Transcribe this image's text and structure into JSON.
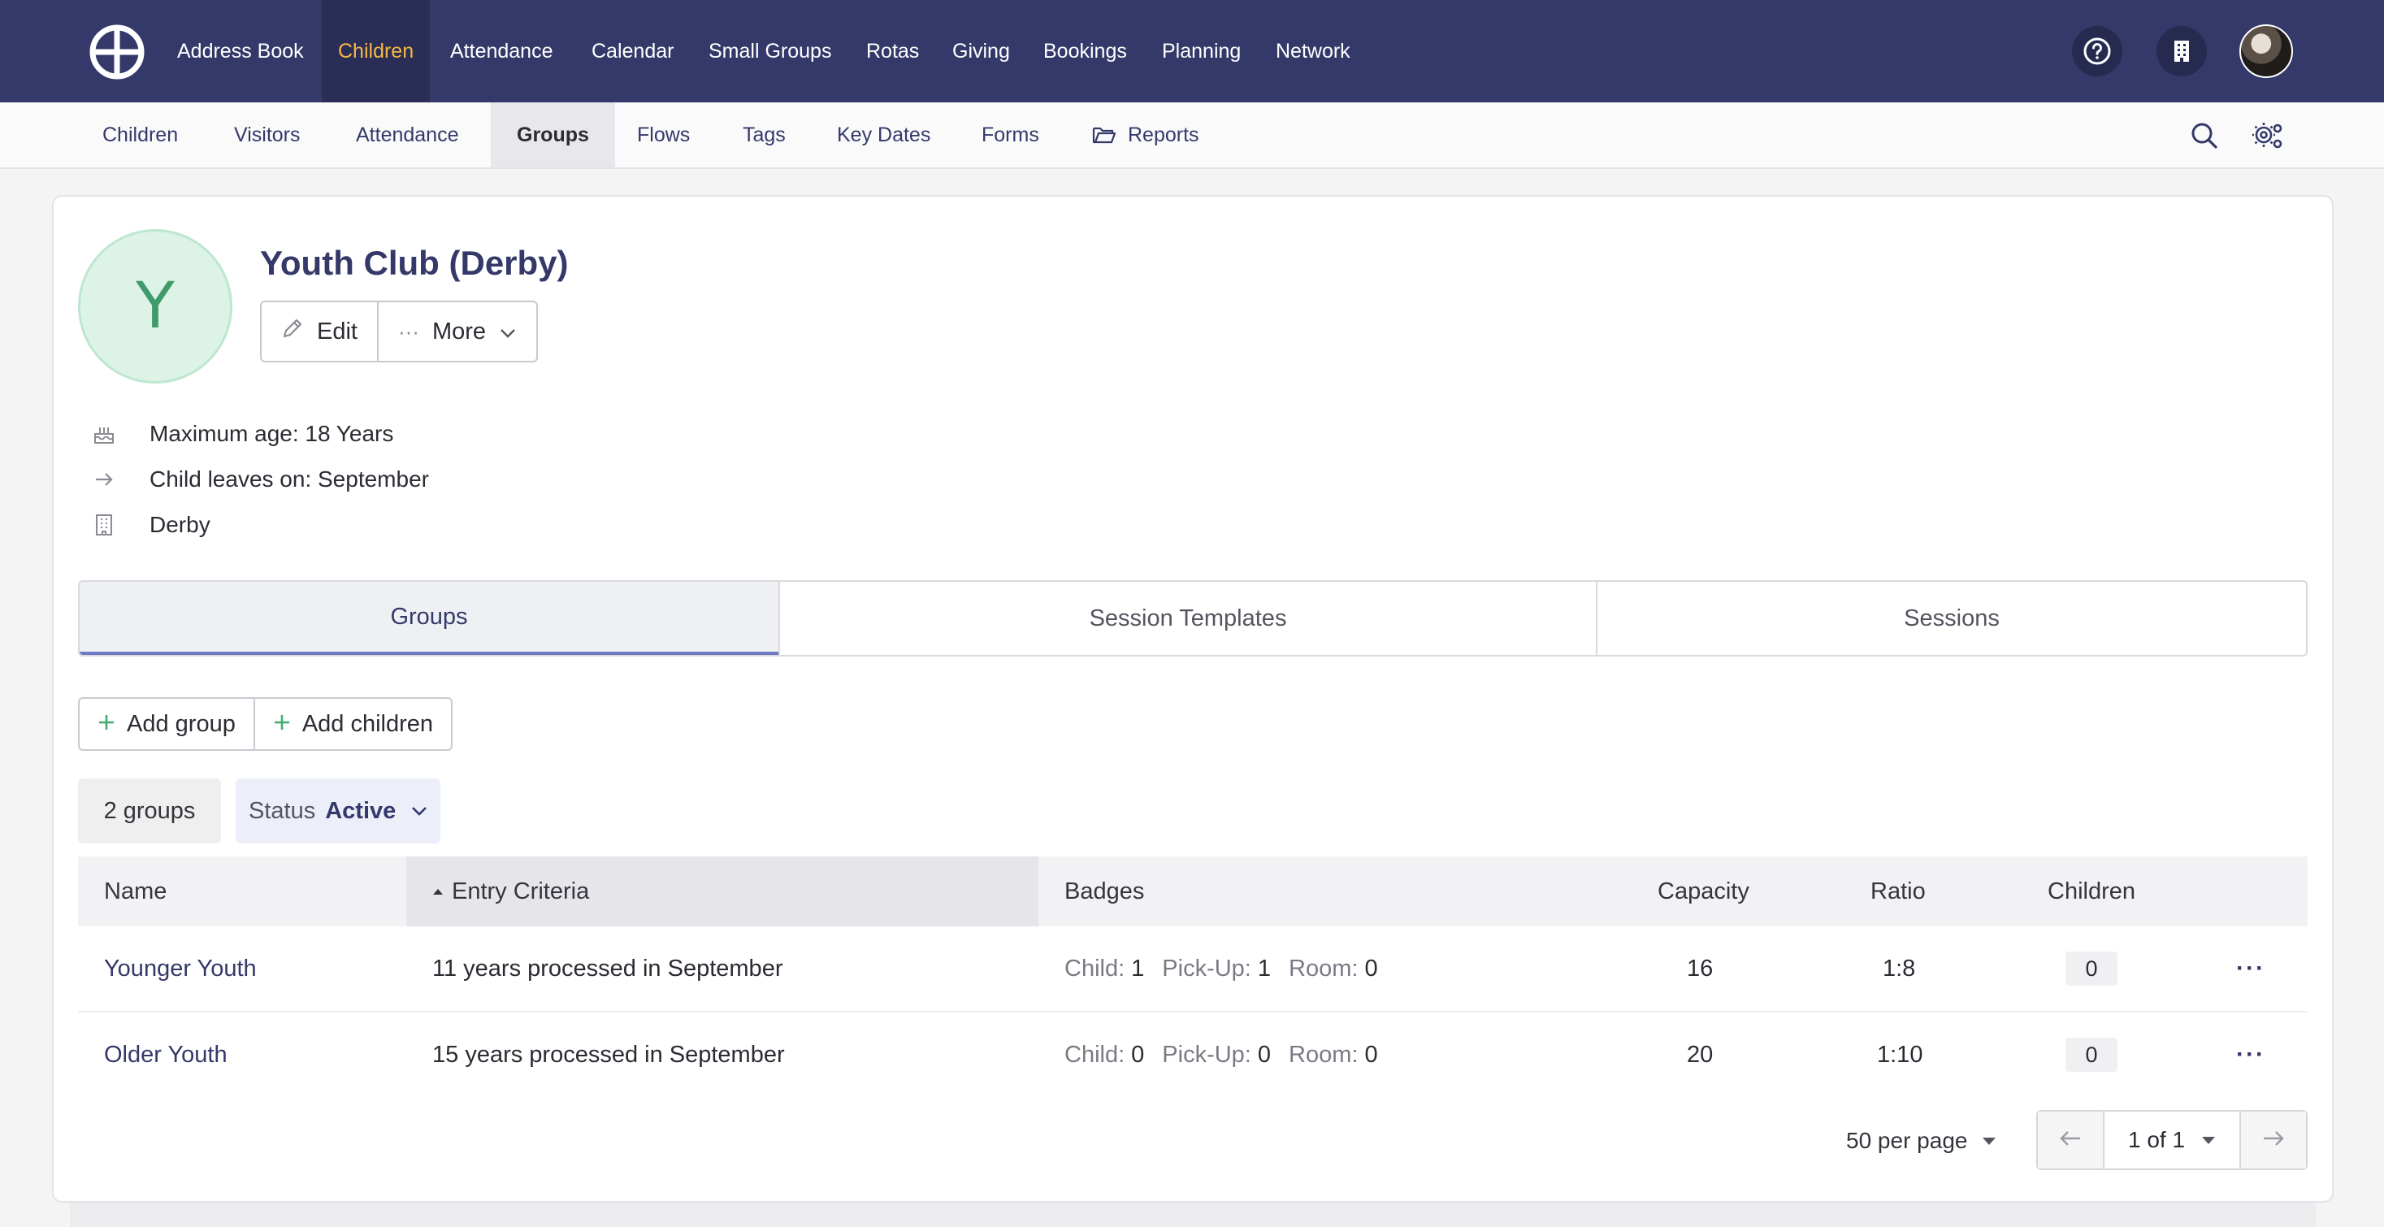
{
  "topnav": {
    "items": [
      {
        "label": "Address Book"
      },
      {
        "label": "Children"
      },
      {
        "label": "Attendance"
      },
      {
        "label": "Calendar"
      },
      {
        "label": "Small Groups"
      },
      {
        "label": "Rotas"
      },
      {
        "label": "Giving"
      },
      {
        "label": "Bookings"
      },
      {
        "label": "Planning"
      },
      {
        "label": "Network"
      }
    ],
    "active": "Children",
    "active_color": "#f4b942",
    "bg_color": "#35396a"
  },
  "subnav": {
    "items": [
      {
        "label": "Children"
      },
      {
        "label": "Visitors"
      },
      {
        "label": "Attendance"
      },
      {
        "label": "Groups"
      },
      {
        "label": "Flows"
      },
      {
        "label": "Tags"
      },
      {
        "label": "Key Dates"
      },
      {
        "label": "Forms"
      },
      {
        "label": "Reports"
      }
    ],
    "active": "Groups"
  },
  "group": {
    "initial": "Y",
    "title": "Youth Club (Derby)",
    "edit_label": "Edit",
    "more_label": "More",
    "max_age": "Maximum age: 18 Years",
    "leaves_on": "Child leaves on: September",
    "site": "Derby"
  },
  "tabs": [
    {
      "label": "Groups"
    },
    {
      "label": "Session Templates"
    },
    {
      "label": "Sessions"
    }
  ],
  "actions": {
    "add_group": "Add group",
    "add_children": "Add children"
  },
  "filters": {
    "count": "2 groups",
    "status_label": "Status",
    "status_value": "Active"
  },
  "table": {
    "headers": {
      "name": "Name",
      "entry": "Entry Criteria",
      "badges": "Badges",
      "capacity": "Capacity",
      "ratio": "Ratio",
      "children": "Children"
    },
    "rows": [
      {
        "name": "Younger Youth",
        "entry": "11 years processed in September",
        "child_label": "Child:",
        "child": "1",
        "pickup_label": "Pick-Up:",
        "pickup": "1",
        "room_label": "Room:",
        "room": "0",
        "capacity": "16",
        "ratio": "1:8",
        "children": "0"
      },
      {
        "name": "Older Youth",
        "entry": "15 years processed in September",
        "child_label": "Child:",
        "child": "0",
        "pickup_label": "Pick-Up:",
        "pickup": "0",
        "room_label": "Room:",
        "room": "0",
        "capacity": "20",
        "ratio": "1:10",
        "children": "0"
      }
    ]
  },
  "pagination": {
    "per_page": "50 per page",
    "page": "1 of 1"
  }
}
